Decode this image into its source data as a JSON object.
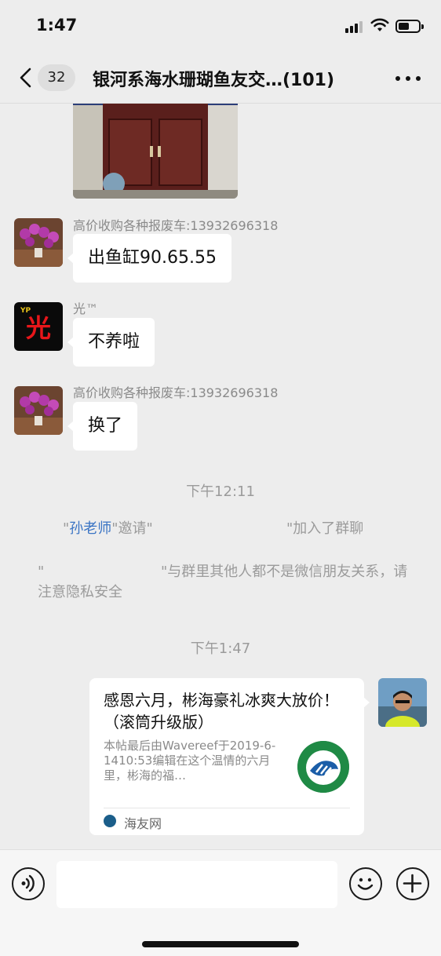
{
  "status_bar": {
    "time": "1:47",
    "battery_level": 0.55
  },
  "header": {
    "unread_count": "32",
    "title": "银河系海水珊瑚鱼友交…(101)"
  },
  "messages": [
    {
      "sender": "高价收购各种报废车:13932696318",
      "text": "出鱼缸90.65.55"
    },
    {
      "sender": "光™",
      "text": "不养啦"
    },
    {
      "sender": "高价收购各种报废车:13932696318",
      "text": "换了"
    }
  ],
  "timestamps": [
    "下午12:11",
    "下午1:47"
  ],
  "system": {
    "invite_q1": "\"",
    "invite_name": "孙老师",
    "invite_mid": "\"邀请\"",
    "invite_end": "\"加入了群聊",
    "warning_q": "\"",
    "warning_text": "\"与群里其他人都不是微信朋友关系，请注意隐私安全"
  },
  "link_card": {
    "title": "感恩六月，彬海豪礼冰爽大放价！（滚筒升级版）",
    "description": "本帖最后由Wavereef于2019-6-1410:53编辑在这个温情的六月里，彬海的福…",
    "source": "海友网"
  },
  "input": {
    "placeholder": ""
  },
  "icons": {
    "back": "chevron-left-icon",
    "more": "more-dots-icon",
    "voice": "voice-icon",
    "emoji": "emoji-icon",
    "plus": "plus-icon"
  },
  "colors": {
    "background": "#ededed",
    "bubble": "#ffffff",
    "link": "#3a74c4",
    "system_text": "#9b9b9b"
  }
}
